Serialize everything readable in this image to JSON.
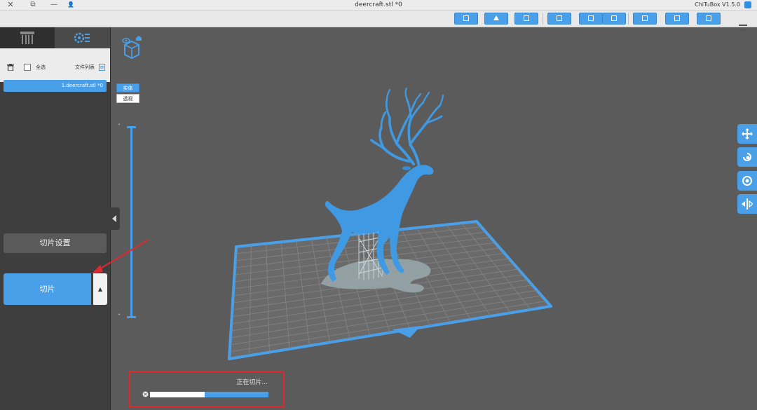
{
  "window": {
    "title": "deercraft.stl *0",
    "app_name": "ChiTuBox V1.5.0",
    "close_glyph": "✕",
    "restore_glyph": "⧉",
    "minimize_glyph": "—",
    "user_glyph": "👤"
  },
  "toolbar": {
    "buttons": [
      "open-icon",
      "save-icon",
      "export-icon",
      "import-icon",
      "copy-icon",
      "layout-icon",
      "grid-icon",
      "home-icon",
      "crop-icon"
    ],
    "menu_icon": "hamburger-icon"
  },
  "left_panel": {
    "tabs": [
      "support-tab",
      "settings-tab"
    ],
    "toolbox": {
      "file_list_label": "文件列表",
      "select_all_label": "全选",
      "select_all_checked": false
    },
    "files": [
      "1.deercraft.stl *0"
    ],
    "slice_settings_label": "切片设置",
    "slice_label": "切片",
    "slice_arrow": "▲"
  },
  "viewport": {
    "view_modes": {
      "solid": "实体",
      "xray": "透视",
      "active": "solid"
    },
    "slider_top_arrow": "˅",
    "slider_bottom_arrow": "˄",
    "right_tools": [
      "move-icon",
      "rotate-icon",
      "scale-icon",
      "mirror-icon"
    ]
  },
  "progress": {
    "label": "正在切片...",
    "fraction": 0.54
  },
  "colors": {
    "accent": "#4aa0e8",
    "model": "#3f9ae3",
    "highlight": "#e0292f"
  }
}
